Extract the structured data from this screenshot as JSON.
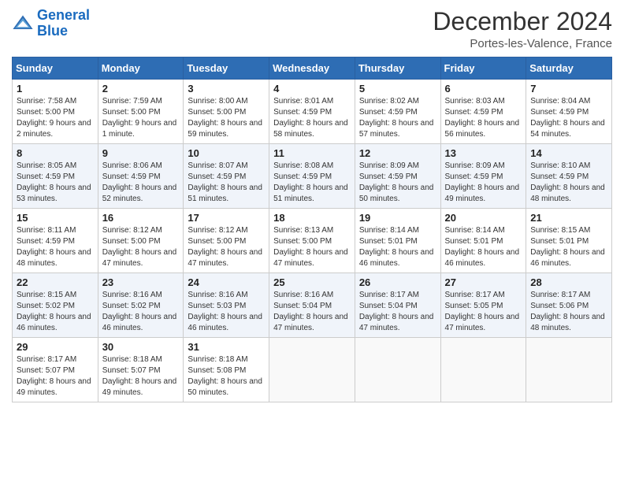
{
  "logo": {
    "line1": "General",
    "line2": "Blue"
  },
  "title": "December 2024",
  "location": "Portes-les-Valence, France",
  "headers": [
    "Sunday",
    "Monday",
    "Tuesday",
    "Wednesday",
    "Thursday",
    "Friday",
    "Saturday"
  ],
  "weeks": [
    [
      {
        "day": "1",
        "sunrise": "7:58 AM",
        "sunset": "5:00 PM",
        "daylight": "9 hours and 2 minutes."
      },
      {
        "day": "2",
        "sunrise": "7:59 AM",
        "sunset": "5:00 PM",
        "daylight": "9 hours and 1 minute."
      },
      {
        "day": "3",
        "sunrise": "8:00 AM",
        "sunset": "5:00 PM",
        "daylight": "8 hours and 59 minutes."
      },
      {
        "day": "4",
        "sunrise": "8:01 AM",
        "sunset": "4:59 PM",
        "daylight": "8 hours and 58 minutes."
      },
      {
        "day": "5",
        "sunrise": "8:02 AM",
        "sunset": "4:59 PM",
        "daylight": "8 hours and 57 minutes."
      },
      {
        "day": "6",
        "sunrise": "8:03 AM",
        "sunset": "4:59 PM",
        "daylight": "8 hours and 56 minutes."
      },
      {
        "day": "7",
        "sunrise": "8:04 AM",
        "sunset": "4:59 PM",
        "daylight": "8 hours and 54 minutes."
      }
    ],
    [
      {
        "day": "8",
        "sunrise": "8:05 AM",
        "sunset": "4:59 PM",
        "daylight": "8 hours and 53 minutes."
      },
      {
        "day": "9",
        "sunrise": "8:06 AM",
        "sunset": "4:59 PM",
        "daylight": "8 hours and 52 minutes."
      },
      {
        "day": "10",
        "sunrise": "8:07 AM",
        "sunset": "4:59 PM",
        "daylight": "8 hours and 51 minutes."
      },
      {
        "day": "11",
        "sunrise": "8:08 AM",
        "sunset": "4:59 PM",
        "daylight": "8 hours and 51 minutes."
      },
      {
        "day": "12",
        "sunrise": "8:09 AM",
        "sunset": "4:59 PM",
        "daylight": "8 hours and 50 minutes."
      },
      {
        "day": "13",
        "sunrise": "8:09 AM",
        "sunset": "4:59 PM",
        "daylight": "8 hours and 49 minutes."
      },
      {
        "day": "14",
        "sunrise": "8:10 AM",
        "sunset": "4:59 PM",
        "daylight": "8 hours and 48 minutes."
      }
    ],
    [
      {
        "day": "15",
        "sunrise": "8:11 AM",
        "sunset": "4:59 PM",
        "daylight": "8 hours and 48 minutes."
      },
      {
        "day": "16",
        "sunrise": "8:12 AM",
        "sunset": "5:00 PM",
        "daylight": "8 hours and 47 minutes."
      },
      {
        "day": "17",
        "sunrise": "8:12 AM",
        "sunset": "5:00 PM",
        "daylight": "8 hours and 47 minutes."
      },
      {
        "day": "18",
        "sunrise": "8:13 AM",
        "sunset": "5:00 PM",
        "daylight": "8 hours and 47 minutes."
      },
      {
        "day": "19",
        "sunrise": "8:14 AM",
        "sunset": "5:01 PM",
        "daylight": "8 hours and 46 minutes."
      },
      {
        "day": "20",
        "sunrise": "8:14 AM",
        "sunset": "5:01 PM",
        "daylight": "8 hours and 46 minutes."
      },
      {
        "day": "21",
        "sunrise": "8:15 AM",
        "sunset": "5:01 PM",
        "daylight": "8 hours and 46 minutes."
      }
    ],
    [
      {
        "day": "22",
        "sunrise": "8:15 AM",
        "sunset": "5:02 PM",
        "daylight": "8 hours and 46 minutes."
      },
      {
        "day": "23",
        "sunrise": "8:16 AM",
        "sunset": "5:02 PM",
        "daylight": "8 hours and 46 minutes."
      },
      {
        "day": "24",
        "sunrise": "8:16 AM",
        "sunset": "5:03 PM",
        "daylight": "8 hours and 46 minutes."
      },
      {
        "day": "25",
        "sunrise": "8:16 AM",
        "sunset": "5:04 PM",
        "daylight": "8 hours and 47 minutes."
      },
      {
        "day": "26",
        "sunrise": "8:17 AM",
        "sunset": "5:04 PM",
        "daylight": "8 hours and 47 minutes."
      },
      {
        "day": "27",
        "sunrise": "8:17 AM",
        "sunset": "5:05 PM",
        "daylight": "8 hours and 47 minutes."
      },
      {
        "day": "28",
        "sunrise": "8:17 AM",
        "sunset": "5:06 PM",
        "daylight": "8 hours and 48 minutes."
      }
    ],
    [
      {
        "day": "29",
        "sunrise": "8:17 AM",
        "sunset": "5:07 PM",
        "daylight": "8 hours and 49 minutes."
      },
      {
        "day": "30",
        "sunrise": "8:18 AM",
        "sunset": "5:07 PM",
        "daylight": "8 hours and 49 minutes."
      },
      {
        "day": "31",
        "sunrise": "8:18 AM",
        "sunset": "5:08 PM",
        "daylight": "8 hours and 50 minutes."
      },
      null,
      null,
      null,
      null
    ]
  ]
}
